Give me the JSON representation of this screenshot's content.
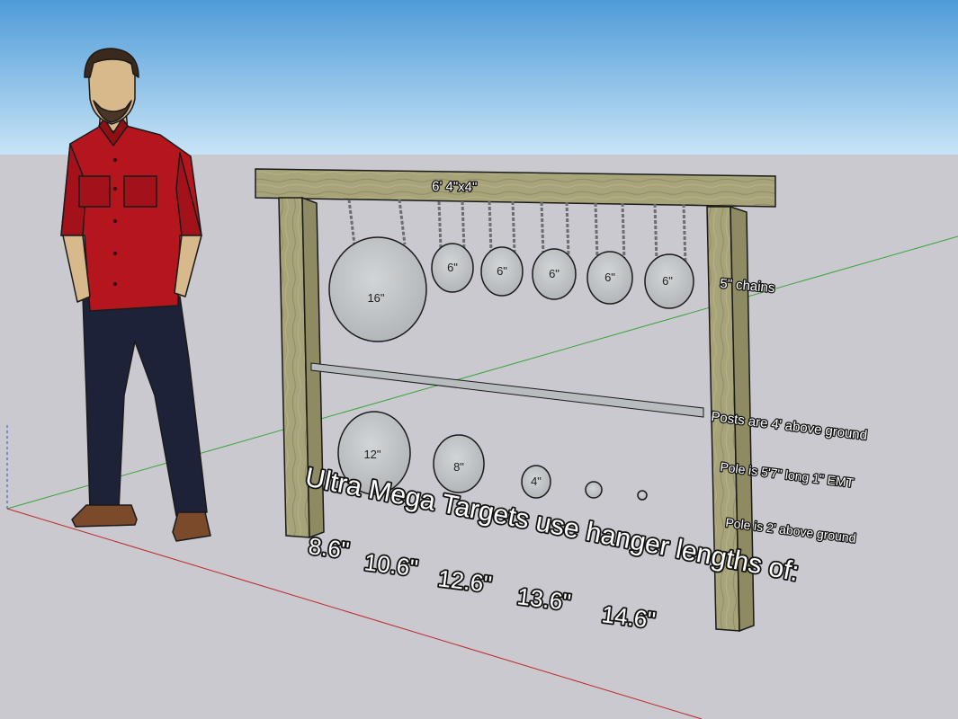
{
  "scene": {
    "colors": {
      "sky_top": "#4f9bd8",
      "sky_bottom": "#c7e4f6",
      "ground": "#c9c9cf",
      "wood": "#a8a47a",
      "wood_dark": "#8e8a62",
      "steel": "#bfc2c4",
      "shirt": "#b5161d",
      "pants": "#1d2238",
      "skin": "#d7b98c"
    }
  },
  "labels": {
    "beam": "6' 4\"x4\"",
    "chains": "5\" chains",
    "posts": "Posts are 4' above ground",
    "pole_length": "Pole is 5'7\" long 1\" EMT",
    "pole_height": "Pole is 2' above ground",
    "headline": "Ultra Mega Targets use hanger lengths of:",
    "lengths": [
      "8.6\"",
      "10.6\"",
      "12.6\"",
      "13.6\"",
      "14.6\""
    ]
  },
  "targets": {
    "upper": [
      "16\"",
      "6\"",
      "6\"",
      "6\"",
      "6\"",
      "6\""
    ],
    "lower": [
      "12\"",
      "8\"",
      "4\""
    ]
  },
  "icons": {
    "person": "person-figure",
    "chain": "chain-icon"
  }
}
